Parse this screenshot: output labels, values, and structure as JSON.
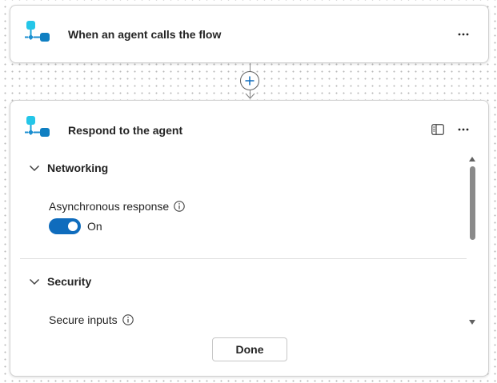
{
  "trigger": {
    "title": "When an agent calls the flow",
    "icon": "flow-agent-icon",
    "more": "more-options-icon"
  },
  "connector": {
    "add": "add-icon"
  },
  "action": {
    "title": "Respond to the agent",
    "icon": "flow-agent-icon",
    "sections": {
      "networking": {
        "title": "Networking",
        "field_label": "Asynchronous response",
        "toggle_state": "On",
        "toggle_on": true
      },
      "security": {
        "title": "Security",
        "field_label": "Secure inputs"
      }
    },
    "done_label": "Done"
  },
  "colors": {
    "accent": "#0f6cbd",
    "icon_light": "#24c6e8",
    "icon_dark": "#0f7fc2",
    "border": "#d1d1d1",
    "text": "#242424"
  }
}
